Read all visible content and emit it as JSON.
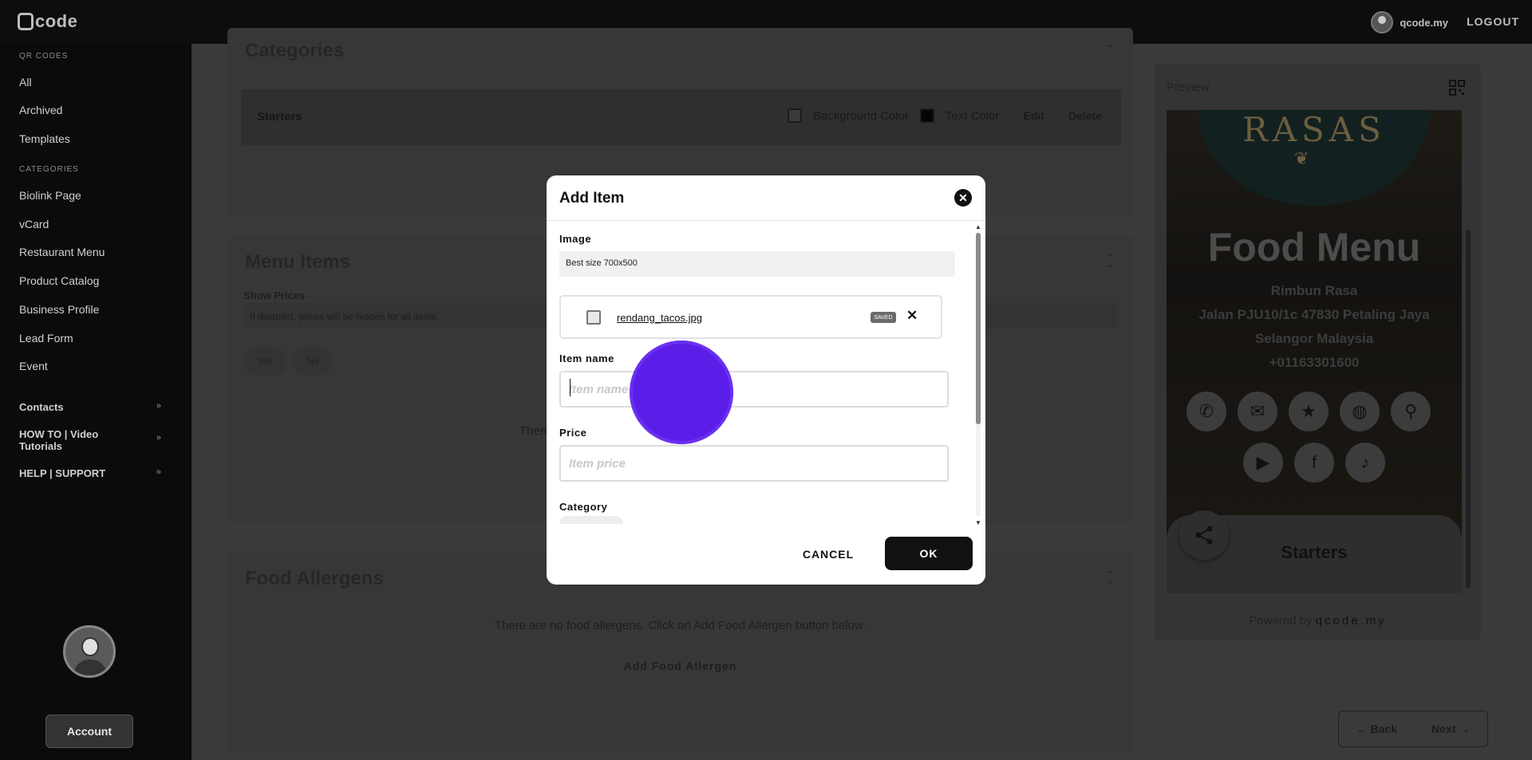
{
  "header": {
    "brand": "code",
    "user": "qcode.my",
    "logout": "LOGOUT"
  },
  "sidebar": {
    "qr_section": "QR CODES",
    "qr_items": [
      "All",
      "Archived",
      "Templates"
    ],
    "cat_section": "CATEGORIES",
    "cat_items": [
      "Biolink Page",
      "vCard",
      "Restaurant Menu",
      "Product Catalog",
      "Business Profile",
      "Lead Form",
      "Event"
    ],
    "groups": [
      "Contacts",
      "HOW TO | Video Tutorials",
      "HELP | SUPPORT"
    ],
    "group_chevron": "»",
    "account": "Account"
  },
  "categories": {
    "title": "Categories",
    "row": {
      "name": "Starters",
      "bg_label": "Background Color",
      "text_label": "Text Color",
      "edit": "Edit",
      "delete": "Delete"
    }
  },
  "menu_items": {
    "title": "Menu Items",
    "show_prices": "Show Prices",
    "show_prices_hint": "If disabled, prices will be hidden for all items",
    "yes": "Yes",
    "no": "No",
    "empty_partial": "There"
  },
  "allergens": {
    "title": "Food Allergens",
    "empty": "There are no food allergens. Click on Add Food Allergen button below.",
    "add": "Add Food Allergen"
  },
  "preview": {
    "label": "Preview",
    "logo_text": "RASAS",
    "heading": "Food Menu",
    "address_lines": [
      "Rimbun Rasa",
      "Jalan PJU10/1c 47830 Petaling Jaya",
      "Selangor Malaysia",
      "+01163301600"
    ],
    "social_icons": [
      "phone-icon",
      "email-icon",
      "star-icon",
      "globe-icon",
      "location-pin-icon",
      "youtube-icon",
      "facebook-icon",
      "tiktok-icon"
    ],
    "section": "Starters",
    "powered_by": "Powered by",
    "powered_brand": "qcode.my"
  },
  "nav": {
    "back": "Back",
    "next": "Next"
  },
  "modal": {
    "title": "Add Item",
    "image_label": "Image",
    "image_hint": "Best size 700x500",
    "file_name": "rendang_tacos.jpg",
    "file_badge": "SAVED",
    "item_name_label": "Item name",
    "item_name_placeholder": "Item name",
    "price_label": "Price",
    "price_placeholder": "Item price",
    "category_label": "Category",
    "cancel": "CANCEL",
    "ok": "OK"
  },
  "colors": {
    "accent_touch": "#5a1ee8",
    "overlay": "#3a3a3a",
    "ok_button": "#111111"
  }
}
